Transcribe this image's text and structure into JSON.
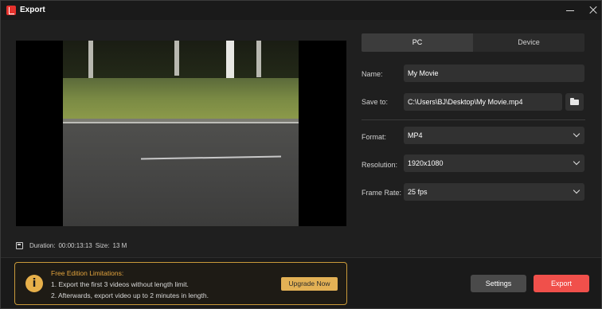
{
  "window": {
    "title": "Export"
  },
  "preview": {
    "duration_label": "Duration:",
    "duration_value": "00:00:13:13",
    "size_label": "Size:",
    "size_value": "13 M"
  },
  "tabs": [
    {
      "label": "PC",
      "active": true
    },
    {
      "label": "Device",
      "active": false
    }
  ],
  "form": {
    "name": {
      "label": "Name:",
      "value": "My Movie"
    },
    "save_to": {
      "label": "Save to:",
      "value": "C:\\Users\\BJ\\Desktop\\My Movie.mp4"
    },
    "format": {
      "label": "Format:",
      "value": "MP4"
    },
    "resolution": {
      "label": "Resolution:",
      "value": "1920x1080"
    },
    "frame_rate": {
      "label": "Frame Rate:",
      "value": "25 fps"
    }
  },
  "notice": {
    "title": "Free Edition Limitations:",
    "line1": "1. Export the first 3 videos without length limit.",
    "line2": "2. Afterwards, export video up to 2 minutes in length.",
    "upgrade_label": "Upgrade Now"
  },
  "buttons": {
    "settings": "Settings",
    "export": "Export"
  },
  "colors": {
    "accent": "#f0504b",
    "warning": "#e3a43d",
    "upgrade": "#e3b155"
  }
}
